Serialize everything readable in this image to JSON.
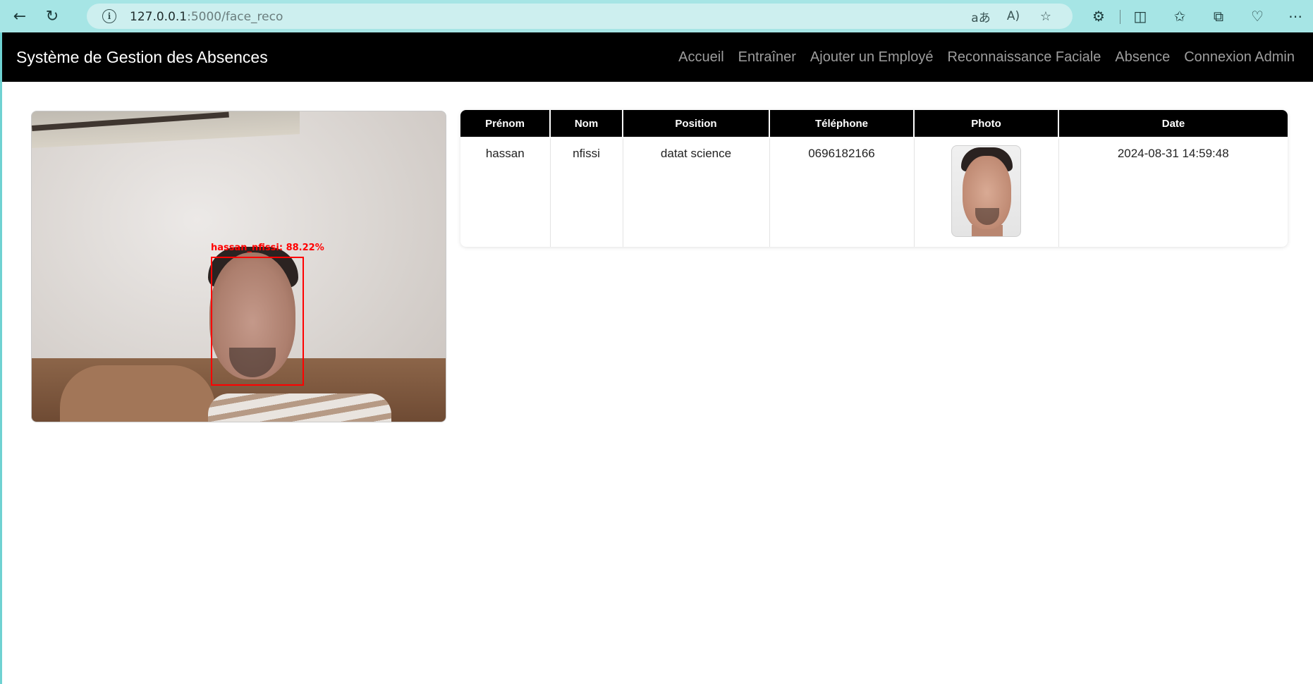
{
  "browser": {
    "back_icon": "arrow-left-icon",
    "refresh_icon": "refresh-icon",
    "url_host": "127.0.0.1",
    "url_rest": ":5000/face_reco",
    "icons": [
      "read-aloud-translate-icon",
      "read-aloud-icon",
      "favorite-star-icon",
      "extensions-icon",
      "split-screen-icon",
      "favorites-icon",
      "collections-icon",
      "browser-essentials-icon",
      "more-menu-icon"
    ]
  },
  "navbar": {
    "brand": "Système de Gestion des Absences",
    "links": [
      "Accueil",
      "Entraîner",
      "Ajouter un Employé",
      "Reconnaissance Faciale",
      "Absence",
      "Connexion Admin"
    ]
  },
  "camera": {
    "detection_label": "hassan_nfissi: 88.22%",
    "box_color": "#ff0000"
  },
  "table": {
    "headers": [
      "Prénom",
      "Nom",
      "Position",
      "Téléphone",
      "Photo",
      "Date"
    ],
    "rows": [
      {
        "prenom": "hassan",
        "nom": "nfissi",
        "position": "datat science",
        "telephone": "0696182166",
        "date": "2024-08-31 14:59:48"
      }
    ]
  },
  "colors": {
    "browser_chrome": "#a6e5e5",
    "navbar_bg": "#000000",
    "nav_link": "#9d9d9d",
    "table_header_bg": "#000000"
  }
}
